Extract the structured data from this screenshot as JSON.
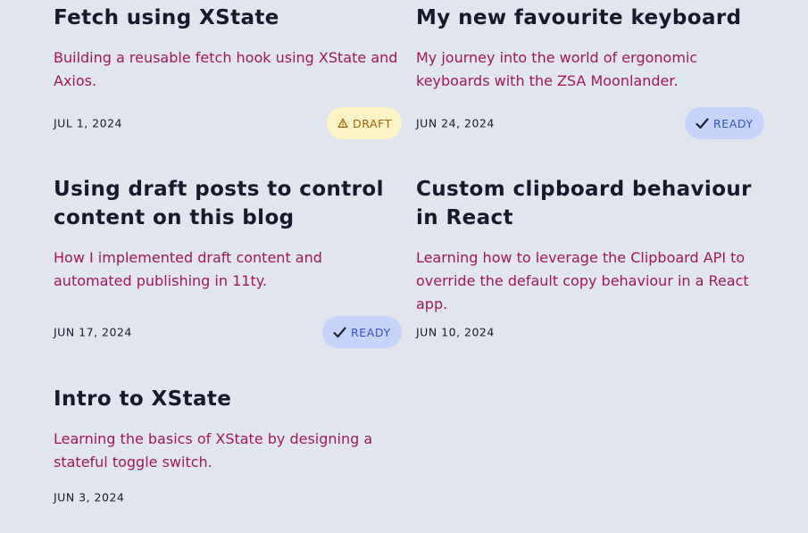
{
  "posts": [
    {
      "title": "Fetch using XState",
      "description": "Building a reusable fetch hook using XState and Axios.",
      "date": "JUL 1, 2024",
      "status": "DRAFT",
      "status_icon": "warning-icon"
    },
    {
      "title": "My new favourite keyboard",
      "description": "My journey into the world of ergonomic keyboards with the ZSA Moonlander.",
      "date": "JUN 24, 2024",
      "status": "READY",
      "status_icon": "checkmark-icon"
    },
    {
      "title": "Using draft posts to control content on this blog",
      "description": "How I implemented draft content and automated publishing in 11ty.",
      "date": "JUN 17, 2024",
      "status": "READY",
      "status_icon": "checkmark-icon"
    },
    {
      "title": "Custom clipboard behaviour in React",
      "description": "Learning how to leverage the Clipboard API to override the default copy behaviour in a React app.",
      "date": "JUN 10, 2024"
    },
    {
      "title": "Intro to XState",
      "description": "Learning the basics of XState by designing a stateful toggle switch.",
      "date": "JUN 3, 2024"
    }
  ],
  "colors": {
    "background": "#e1e5ee",
    "title": "#161a2c",
    "description": "#a2185a",
    "draft_badge_bg": "#fdf3c4",
    "draft_badge_text": "#a35f09",
    "ready_badge_bg": "#c6d3fb",
    "ready_badge_text": "#3552d8"
  }
}
